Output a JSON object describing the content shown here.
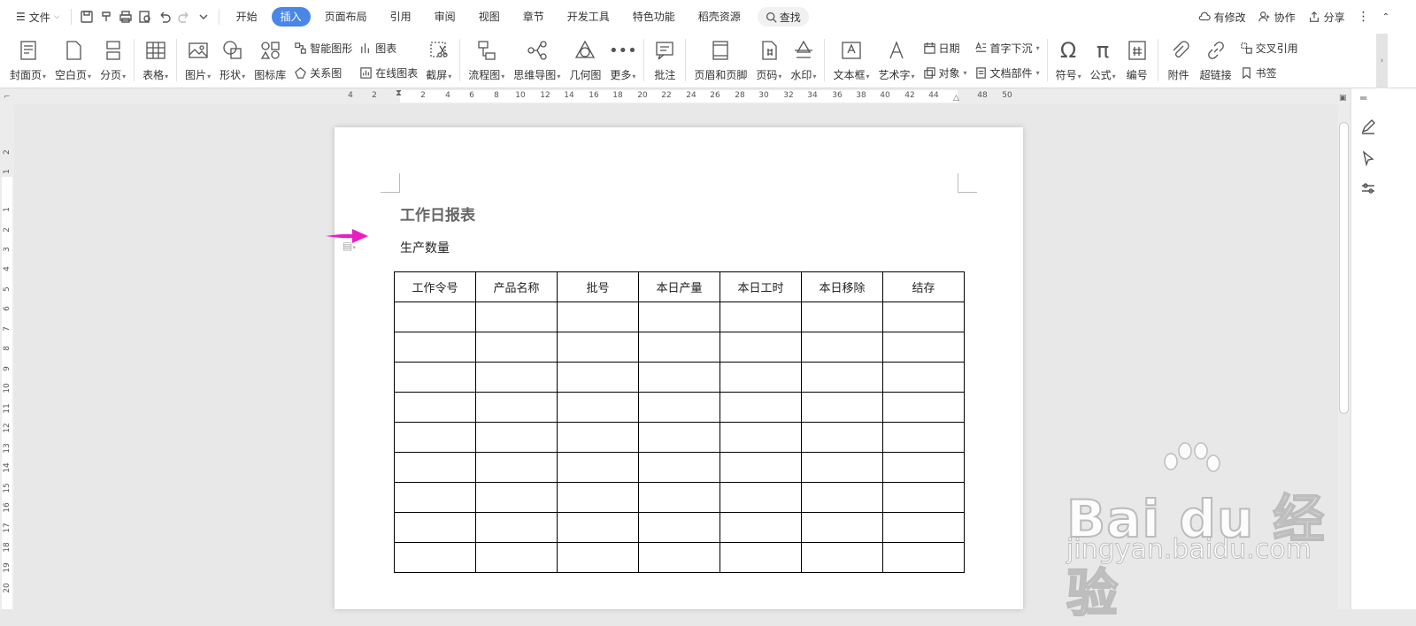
{
  "menubar": {
    "file_label": "文件",
    "tabs": [
      "开始",
      "插入",
      "页面布局",
      "引用",
      "审阅",
      "视图",
      "章节",
      "开发工具",
      "特色功能",
      "稻壳资源"
    ],
    "search_label": "查找",
    "right": {
      "modified": "有修改",
      "collab": "协作",
      "share": "分享"
    }
  },
  "ribbon": {
    "cover": "封面页",
    "blank": "空白页",
    "break": "分页",
    "table": "表格",
    "picture": "图片",
    "shape": "形状",
    "iconlib": "图标库",
    "smartart": "智能图形",
    "chart": "图表",
    "relation": "关系图",
    "onlinechart": "在线图表",
    "screenshot": "截屏",
    "flowchart": "流程图",
    "mindmap": "思维导图",
    "geometry": "几何图",
    "more": "更多",
    "comment": "批注",
    "headerfooter": "页眉和页脚",
    "pagenum": "页码",
    "watermark": "水印",
    "textbox": "文本框",
    "wordart": "艺术字",
    "date": "日期",
    "dropcap": "首字下沉",
    "object": "对象",
    "docpart": "文档部件",
    "symbol": "符号",
    "formula": "公式",
    "numbering": "编号",
    "attachment": "附件",
    "hyperlink": "超链接",
    "crossref": "交叉引用",
    "bookmark": "书签"
  },
  "hruler": [
    "4",
    "2",
    "2",
    "4",
    "6",
    "8",
    "10",
    "12",
    "14",
    "16",
    "18",
    "20",
    "22",
    "24",
    "26",
    "28",
    "30",
    "32",
    "34",
    "36",
    "38",
    "40",
    "42",
    "44",
    "48",
    "50"
  ],
  "vruler": [
    "2",
    "1",
    "1",
    "2",
    "3",
    "4",
    "5",
    "6",
    "7",
    "8",
    "9",
    "10",
    "11",
    "12",
    "13",
    "14",
    "15",
    "16",
    "17",
    "18",
    "19",
    "20"
  ],
  "document": {
    "title": "工作日报表",
    "subtitle": "生产数量",
    "table_headers": [
      "工作令号",
      "产品名称",
      "批号",
      "本日产量",
      "本日工时",
      "本日移除",
      "结存"
    ],
    "empty_rows": 9
  },
  "watermark": {
    "main": "Bai du 经验",
    "url": "jingyan.baidu.com"
  },
  "colors": {
    "accent": "#4a86e8",
    "arrow": "#e91ec0"
  }
}
